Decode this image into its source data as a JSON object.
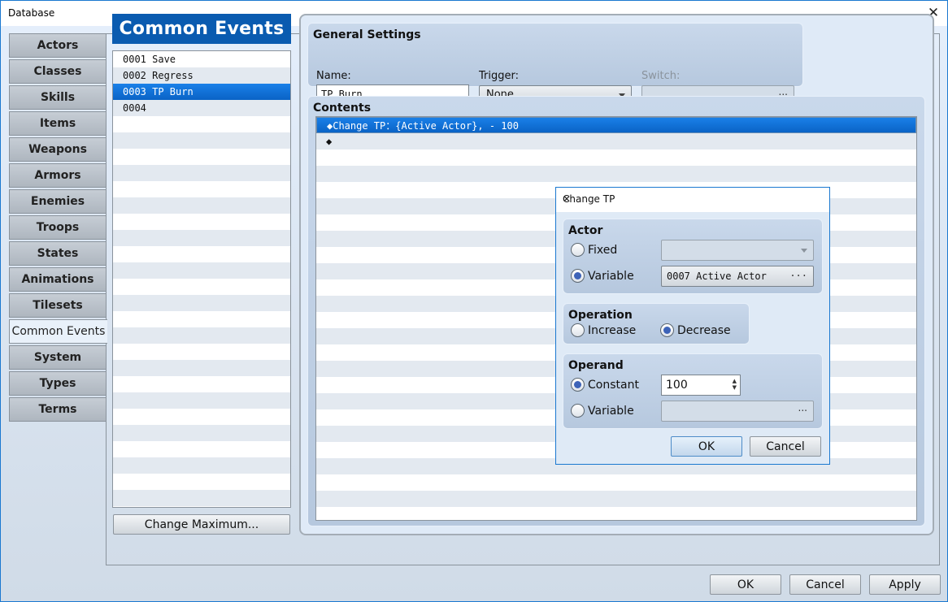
{
  "window": {
    "title": "Database",
    "close_glyph": "✕"
  },
  "tabs": [
    {
      "label": "Actors",
      "active": false
    },
    {
      "label": "Classes",
      "active": false
    },
    {
      "label": "Skills",
      "active": false
    },
    {
      "label": "Items",
      "active": false
    },
    {
      "label": "Weapons",
      "active": false
    },
    {
      "label": "Armors",
      "active": false
    },
    {
      "label": "Enemies",
      "active": false
    },
    {
      "label": "Troops",
      "active": false
    },
    {
      "label": "States",
      "active": false
    },
    {
      "label": "Animations",
      "active": false
    },
    {
      "label": "Tilesets",
      "active": false
    },
    {
      "label": "Common Events",
      "active": true
    },
    {
      "label": "System",
      "active": false
    },
    {
      "label": "Types",
      "active": false
    },
    {
      "label": "Terms",
      "active": false
    }
  ],
  "common_events": {
    "header": "Common Events",
    "items": [
      "0001 Save",
      "0002 Regress",
      "0003 TP Burn",
      "0004"
    ],
    "selected_index": 2,
    "change_max_label": "Change Maximum..."
  },
  "general_settings": {
    "title": "General Settings",
    "name_label": "Name:",
    "name_value": "TP Burn",
    "trigger_label": "Trigger:",
    "trigger_value": "None",
    "switch_label": "Switch:",
    "switch_value": "",
    "ellipsis": "···"
  },
  "contents": {
    "title": "Contents",
    "commands": [
      "◆Change TP：{Active Actor}, - 100",
      "◆"
    ],
    "selected_index": 0
  },
  "footer": {
    "ok": "OK",
    "cancel": "Cancel",
    "apply": "Apply"
  },
  "dialog": {
    "title": "Change TP",
    "close_glyph": "✕",
    "actor": {
      "title": "Actor",
      "fixed_label": "Fixed",
      "variable_label": "Variable",
      "selected": "variable",
      "fixed_value": "",
      "variable_value": "0007 Active Actor"
    },
    "operation": {
      "title": "Operation",
      "increase_label": "Increase",
      "decrease_label": "Decrease",
      "selected": "decrease"
    },
    "operand": {
      "title": "Operand",
      "constant_label": "Constant",
      "variable_label": "Variable",
      "selected": "constant",
      "constant_value": "100",
      "variable_value": ""
    },
    "ok": "OK",
    "cancel": "Cancel",
    "ellipsis": "···"
  }
}
